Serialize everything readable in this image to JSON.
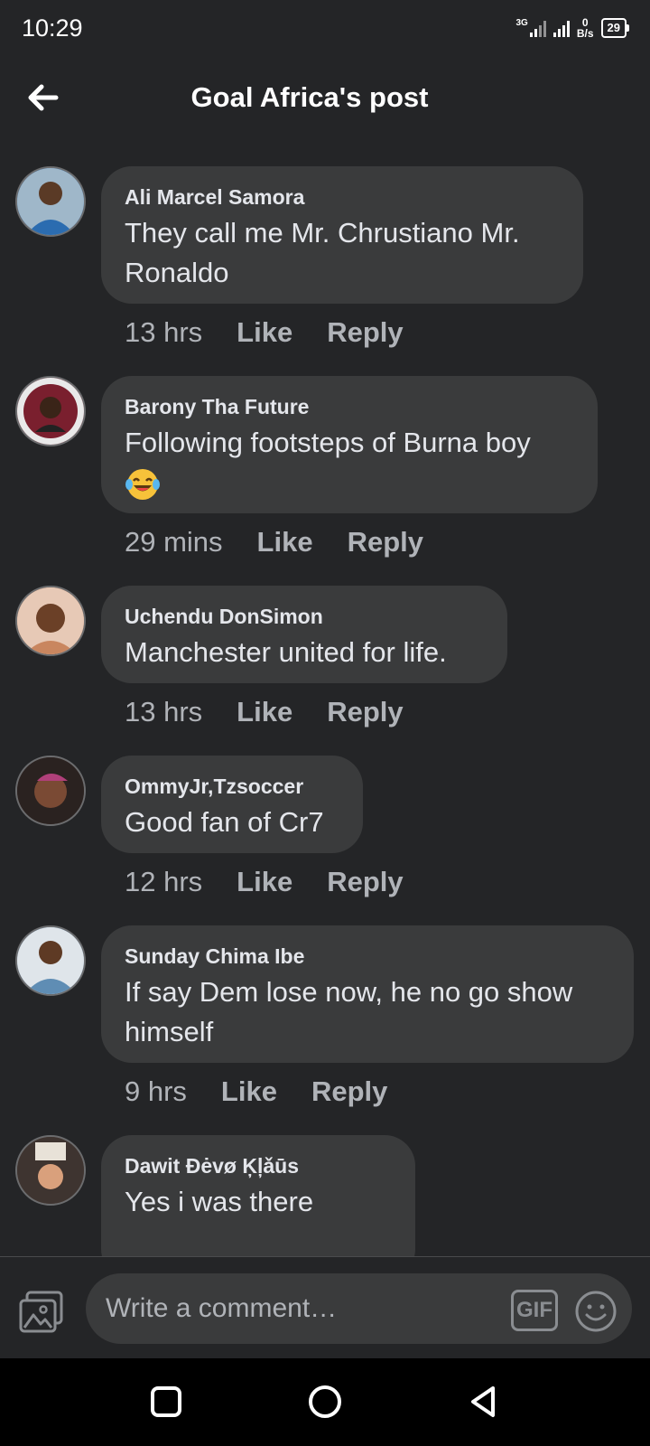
{
  "status_bar": {
    "time": "10:29",
    "network": "3G",
    "speed_value": "0",
    "speed_unit": "B/s",
    "battery": "29"
  },
  "header": {
    "title": "Goal Africa's post",
    "back_icon": "arrow-left-icon"
  },
  "comments": [
    {
      "name": "Ali Marcel Samora",
      "text": "They call me Mr. Chrustiano Mr. Ronaldo",
      "time": "13 hrs",
      "like": "Like",
      "reply": "Reply",
      "avatar_color": "#2d6fb0"
    },
    {
      "name": "Barony Tha Future",
      "text": "Following footsteps of Burna boy",
      "emoji": "tears-of-joy-emoji",
      "time": "29 mins",
      "like": "Like",
      "reply": "Reply",
      "avatar_color": "#8a2a3a"
    },
    {
      "name": "Uchendu DonSimon",
      "text": "Manchester united for life.",
      "time": "13 hrs",
      "like": "Like",
      "reply": "Reply",
      "avatar_color": "#c98d6c"
    },
    {
      "name": "OmmyJr,Tzsoccer",
      "text": "Good fan of Cr7",
      "time": "12 hrs",
      "like": "Like",
      "reply": "Reply",
      "avatar_color": "#4a3a36"
    },
    {
      "name": "Sunday Chima Ibe",
      "text": "If say Dem lose now, he no go show himself",
      "time": "9 hrs",
      "like": "Like",
      "reply": "Reply",
      "avatar_color": "#6b8fb0"
    },
    {
      "name": "Dawit Ðėvø Ķļǎūs",
      "text": "Yes i was there",
      "time": "",
      "like": "",
      "reply": "",
      "avatar_color": "#5a4a44"
    }
  ],
  "composer": {
    "placeholder": "Write a comment…",
    "gif_label": "GIF"
  },
  "colors": {
    "background": "#242527",
    "bubble": "#3a3b3c",
    "text": "#e4e6eb",
    "muted": "#b0b3b8"
  }
}
